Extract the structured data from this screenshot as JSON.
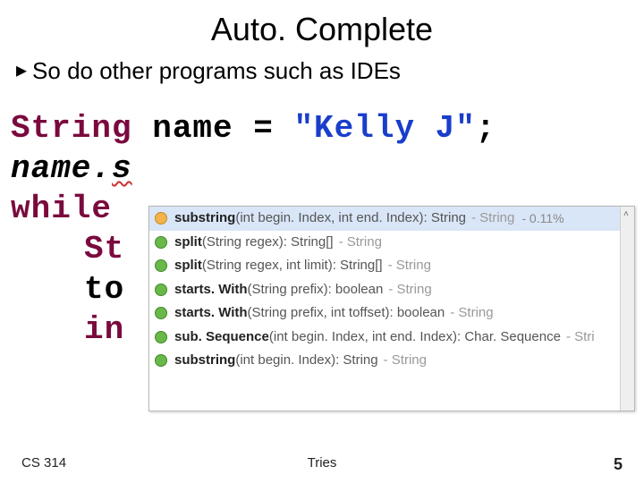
{
  "title": "Auto. Complete",
  "bullet": {
    "icon": "▸",
    "text": "So do other programs such as IDEs"
  },
  "code": {
    "line1_kw": "String",
    "line1_rest_a": " name = ",
    "line1_str": "\"Kelly J\"",
    "line1_rest_b": ";",
    "line2_a": "name.",
    "line2_b": "s",
    "line3": "while",
    "line4": "St",
    "line5": "to",
    "line6": "in"
  },
  "popup": {
    "items": [
      {
        "name": "substring",
        "params": "(int begin. Index, int end. Index)",
        "ret": " : String",
        "tail": "- String",
        "pct": "- 0.11%",
        "iconClass": "icon-orange",
        "selected": true
      },
      {
        "name": "split",
        "params": "(String regex)",
        "ret": " : String[]",
        "tail": "- String",
        "pct": "",
        "iconClass": "icon-green",
        "selected": false
      },
      {
        "name": "split",
        "params": "(String regex, int limit)",
        "ret": " : String[]",
        "tail": "- String",
        "pct": "",
        "iconClass": "icon-green",
        "selected": false
      },
      {
        "name": "starts. With",
        "params": "(String prefix)",
        "ret": " : boolean",
        "tail": "- String",
        "pct": "",
        "iconClass": "icon-green",
        "selected": false
      },
      {
        "name": "starts. With",
        "params": "(String prefix, int toffset)",
        "ret": " : boolean",
        "tail": "- String",
        "pct": "",
        "iconClass": "icon-green",
        "selected": false
      },
      {
        "name": "sub. Sequence",
        "params": "(int begin. Index, int end. Index)",
        "ret": " : Char. Sequence",
        "tail": "- Stri",
        "pct": "",
        "iconClass": "icon-green",
        "selected": false
      },
      {
        "name": "substring",
        "params": "(int begin. Index)",
        "ret": " : String",
        "tail": "- String",
        "pct": "",
        "iconClass": "icon-green",
        "selected": false
      }
    ]
  },
  "footer": {
    "left": "CS 314",
    "center": "Tries",
    "right": "5"
  }
}
